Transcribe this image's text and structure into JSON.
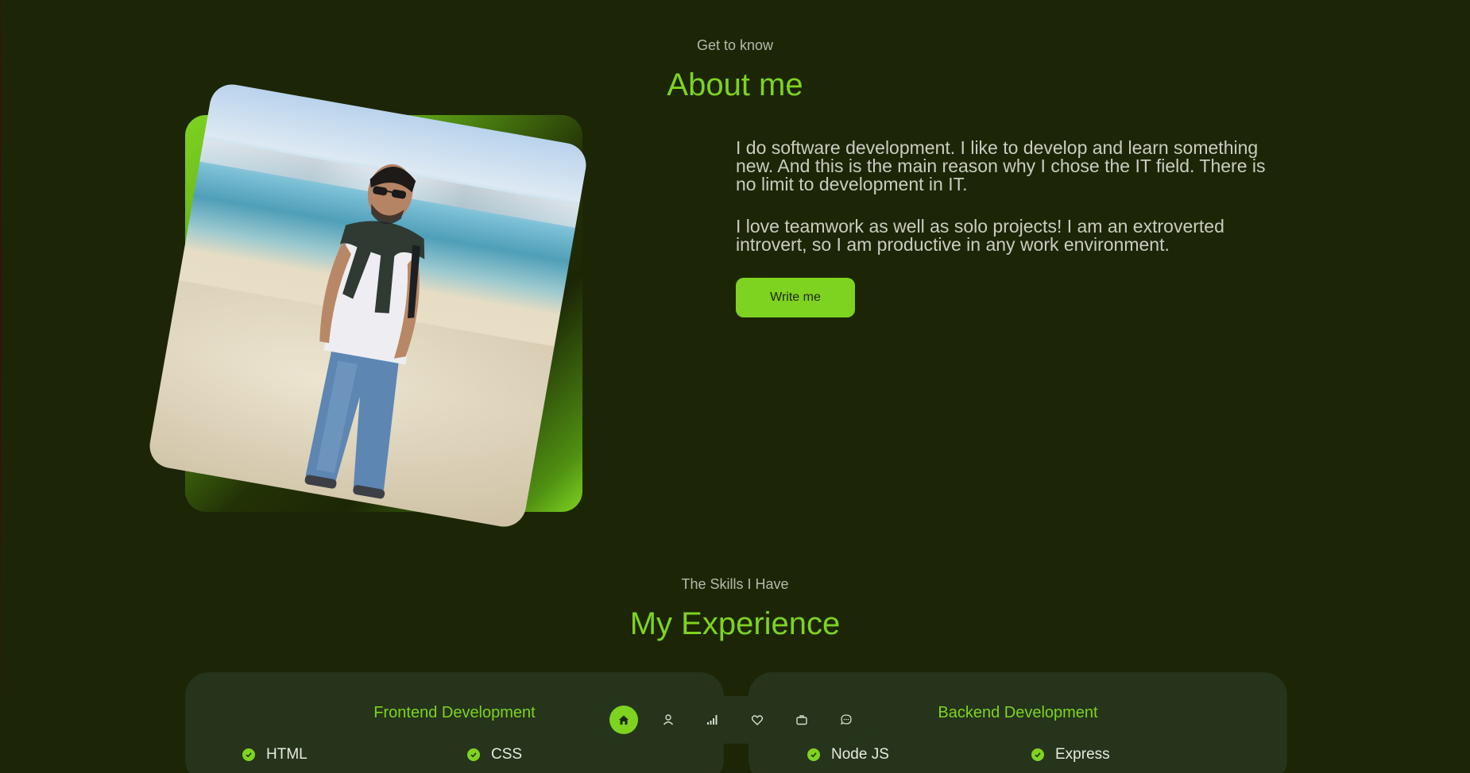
{
  "colors": {
    "background": "#1c2606",
    "accent": "#7ed321",
    "card": "#25341a",
    "text": "#c9ccc0"
  },
  "about": {
    "subtitle": "Get to know",
    "title": "About me",
    "paragraph_1": "I do software development. I like to develop and learn something new. And this is the main reason why I chose the IT field. There is no limit to development in IT.",
    "paragraph_2": "I love teamwork as well as solo projects! I am an extroverted introvert, so I am productive in any work environment.",
    "write_button": "Write me"
  },
  "experience": {
    "subtitle": "The Skills I Have",
    "title": "My Experience",
    "frontend": {
      "title": "Frontend Development",
      "skills": [
        "HTML",
        "CSS"
      ]
    },
    "backend": {
      "title": "Backend Development",
      "skills": [
        "Node JS",
        "Express"
      ]
    }
  },
  "nav": {
    "items": [
      {
        "icon": "home-icon",
        "active": true
      },
      {
        "icon": "user-icon",
        "active": false
      },
      {
        "icon": "signal-icon",
        "active": false
      },
      {
        "icon": "heart-icon",
        "active": false
      },
      {
        "icon": "briefcase-icon",
        "active": false
      },
      {
        "icon": "chat-icon",
        "active": false
      }
    ]
  }
}
